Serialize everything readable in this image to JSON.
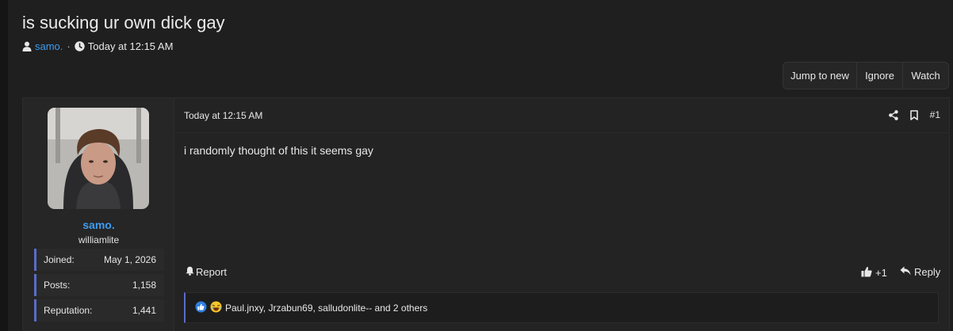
{
  "thread": {
    "title": "is sucking ur own dick gay",
    "author": "samo.",
    "separator": "·",
    "time": "Today at 12:15 AM"
  },
  "actions": {
    "jump_to_new": "Jump to new",
    "ignore": "Ignore",
    "watch": "Watch"
  },
  "user": {
    "name": "samo.",
    "title": "williamlite",
    "stats": [
      {
        "label": "Joined:",
        "value": "May 1, 2026"
      },
      {
        "label": "Posts:",
        "value": "1,158"
      },
      {
        "label": "Reputation:",
        "value": "1,441"
      }
    ]
  },
  "post": {
    "date": "Today at 12:15 AM",
    "number": "#1",
    "body": "i randomly thought of this it seems gay",
    "report_label": "Report",
    "like_count": "+1",
    "reply_label": "Reply",
    "reactions_text": "Paul.jnxy, Jrzabun69, salludonlite-- and 2 others"
  },
  "colors": {
    "accent_blue": "#3d9cf0",
    "stat_border": "#5a6cc8",
    "background": "#1f1f1f"
  },
  "icons": [
    "user-icon",
    "clock-icon",
    "share-icon",
    "bookmark-icon",
    "bell-icon",
    "thumbs-up-icon",
    "reply-icon",
    "like-reaction-icon",
    "laugh-reaction-icon"
  ]
}
